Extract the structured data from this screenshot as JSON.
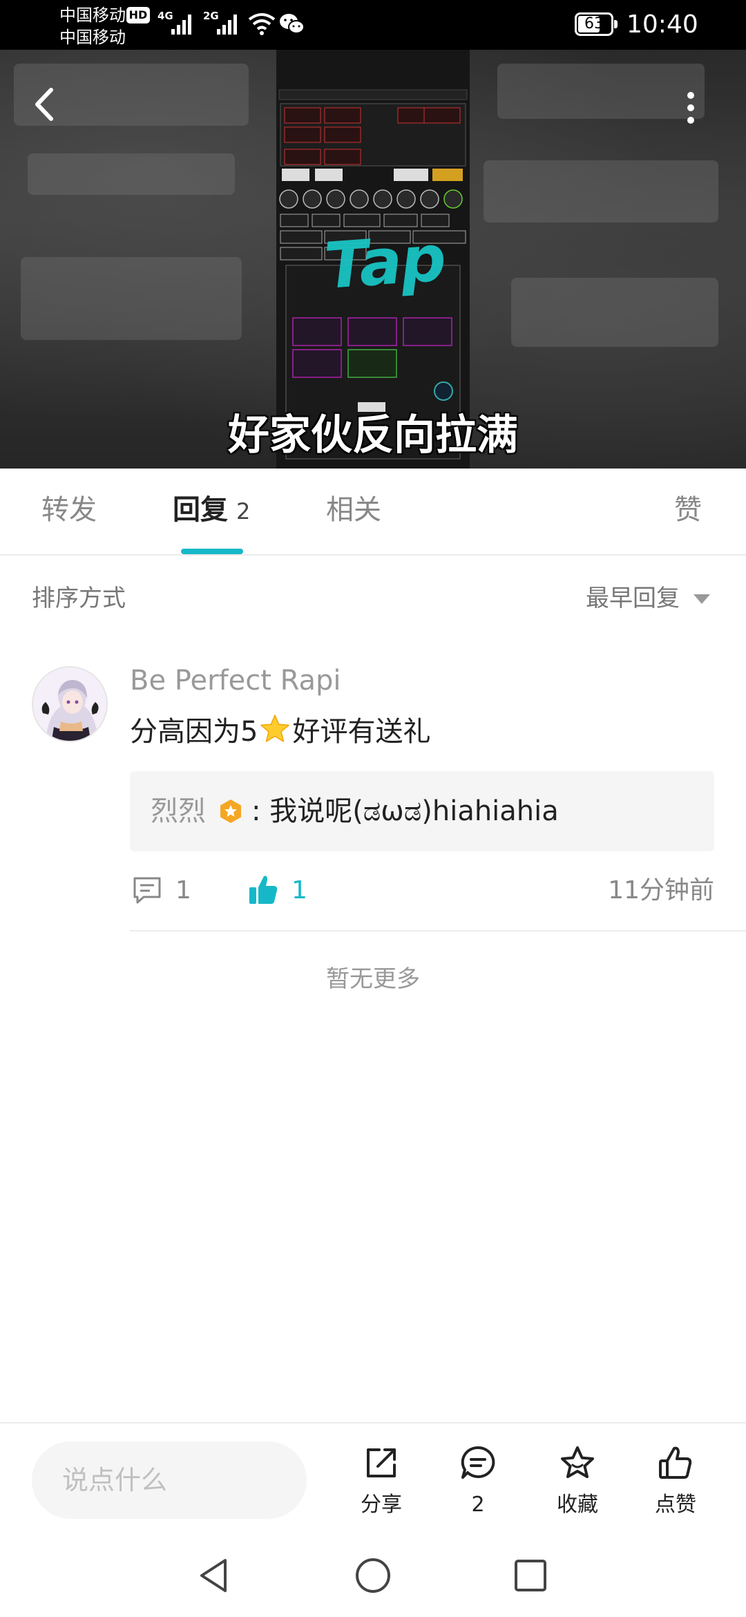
{
  "status_bar": {
    "carrier_1": "中国移动",
    "carrier_2": "中国移动",
    "hd": "HD",
    "network_1": "4G",
    "network_2": "2G",
    "battery": "63",
    "time": "10:40"
  },
  "video": {
    "subtitle": "好家伙反向拉满",
    "logo_text": "Tap",
    "icons": {
      "back": "back-arrow-icon",
      "more": "more-vertical-icon"
    }
  },
  "tabs": [
    {
      "label": "转发",
      "count": ""
    },
    {
      "label": "回复",
      "count": "2"
    },
    {
      "label": "相关",
      "count": ""
    },
    {
      "label": "赞",
      "count": ""
    }
  ],
  "active_tab": "回复",
  "sort": {
    "label": "排序方式",
    "selected": "最早回复"
  },
  "comment": {
    "author": "Be Perfect Rapi",
    "text_before": "分高因为5",
    "text_after": "好评有送礼",
    "reply": {
      "author": "烈烈",
      "text": ": 我说呢(ಡωಡ)hiahiahia"
    },
    "reply_count": "1",
    "like_count": "1",
    "time": "11分钟前"
  },
  "no_more": "暂无更多",
  "bottom_bar": {
    "input_placeholder": "说点什么",
    "share_label": "分享",
    "comments_label": "2",
    "favorite_label": "收藏",
    "like_label": "点赞"
  },
  "colors": {
    "accent": "#16b8c8",
    "text_primary": "#222222",
    "text_secondary": "#888888",
    "badge_orange": "#f5a623"
  }
}
